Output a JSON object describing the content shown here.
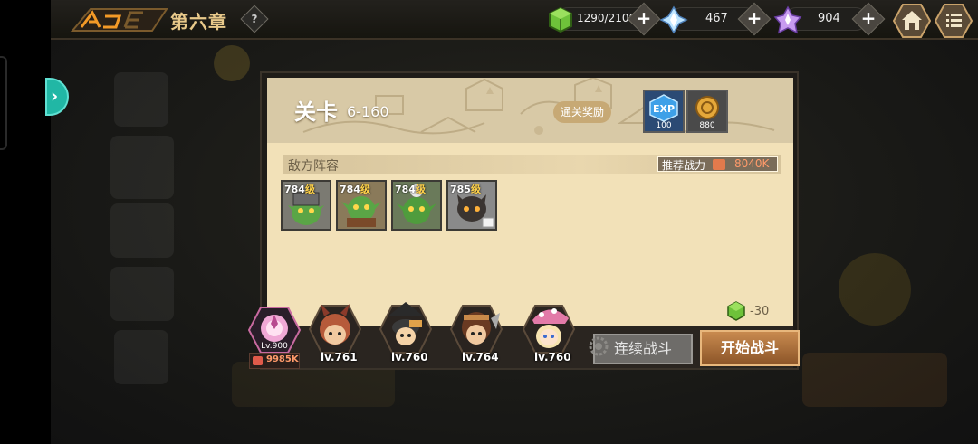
{
  "topbar": {
    "chapter_title": "第六章",
    "help_symbol": "?",
    "stamina": {
      "value": "1290/2100",
      "icon": "green-cube-icon"
    },
    "diamond": {
      "value": "467",
      "icon": "crystal-icon"
    },
    "gem": {
      "value": "904",
      "icon": "purple-gem-icon"
    },
    "plus_symbol": "+",
    "home_icon": "home-icon",
    "menu_icon": "menu-icon"
  },
  "side_arrow_symbol": "›",
  "stage": {
    "label": "关卡",
    "number": "6-160",
    "reward_button": "通关奖励",
    "rewards": [
      {
        "icon": "exp-icon",
        "text": "EXP",
        "count": "100"
      },
      {
        "icon": "gold-coin-icon",
        "count": "880"
      }
    ]
  },
  "enemy": {
    "label": "敌方阵容",
    "power_label": "推荐战力",
    "power_value": "8040K",
    "lineup": [
      {
        "level": "784",
        "unit": "级"
      },
      {
        "level": "784",
        "unit": "级"
      },
      {
        "level": "784",
        "unit": "级"
      },
      {
        "level": "785",
        "unit": "级"
      }
    ]
  },
  "stamina_cost": "-30",
  "team": {
    "leader_level": "Lv.900",
    "power": "9985K",
    "heroes": [
      {
        "level": "lv.761"
      },
      {
        "level": "lv.760"
      },
      {
        "level": "lv.764"
      },
      {
        "level": "lv.760"
      }
    ]
  },
  "buttons": {
    "auto_battle": "连续战斗",
    "start_battle": "开始战斗"
  },
  "colors": {
    "accent_gold": "#e8c98a",
    "start_button": "#c88a4f",
    "teal_tab": "#21b7a5",
    "power_text": "#ff9a6a"
  }
}
